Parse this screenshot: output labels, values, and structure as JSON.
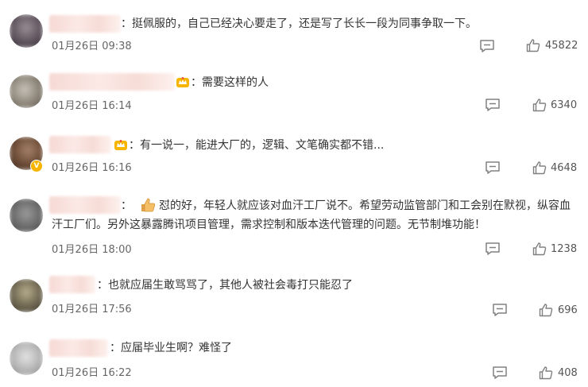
{
  "comments": [
    {
      "text": "：挺佩服的，自己已经决心要走了，还是写了长长一段为同事争取一下。",
      "time": "01月26日 09:38",
      "likes": "45822"
    },
    {
      "text": "：需要这样的人",
      "time": "01月26日 16:14",
      "likes": "6340"
    },
    {
      "text": "：有一说一，能进大厂的，逻辑、文笔确实都不错...",
      "time": "01月26日 16:16",
      "likes": "4648"
    },
    {
      "text_prefix": "：",
      "text": "怼的好，年轻人就应该对血汗工厂说不。希望劳动监管部门和工会别在默视，纵容血汗工厂们。另外这暴露腾讯项目管理，需求控制和版本迭代管理的问题。无节制堆功能！",
      "time": "01月26日 18:00",
      "likes": "1238"
    },
    {
      "text": "：也就应届生敢骂骂了，其他人被社会毒打只能忍了",
      "time": "01月26日 17:56",
      "likes": "696"
    },
    {
      "text": "：应届毕业生啊？难怪了",
      "time": "01月26日 16:22",
      "likes": "408"
    }
  ],
  "icons": {
    "reply": "comment-icon",
    "like": "thumbs-up-icon",
    "badge": "crown-badge-icon",
    "verified": "verified-v-icon",
    "emoji": "thumbs-up-emoji-icon"
  },
  "colors": {
    "text": "#333333",
    "meta": "#666666",
    "icon": "#808080",
    "badge": "#f7b500"
  }
}
